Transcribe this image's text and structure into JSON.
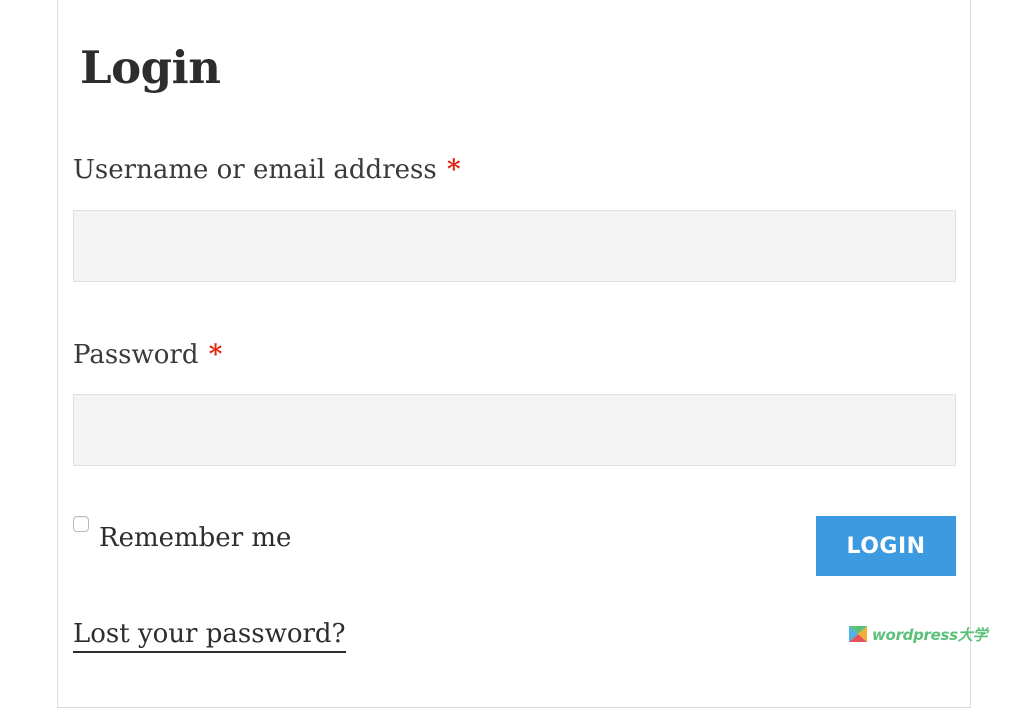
{
  "form": {
    "title": "Login",
    "username": {
      "label": "Username or email address",
      "required_mark": "*",
      "value": "",
      "placeholder": ""
    },
    "password": {
      "label": "Password",
      "required_mark": "*",
      "value": "",
      "placeholder": ""
    },
    "remember": {
      "label": "Remember me",
      "checked": false
    },
    "login_button_label": "LOGIN",
    "lost_password_link": "Lost your password?"
  },
  "watermark": {
    "text": "wordpress大学",
    "icon": "wordpress-daxue-logo-icon"
  },
  "colors": {
    "accent": "#3c9ae0",
    "required": "#e2230f",
    "watermark": "#5cc07b",
    "input_bg": "#f4f4f4"
  }
}
